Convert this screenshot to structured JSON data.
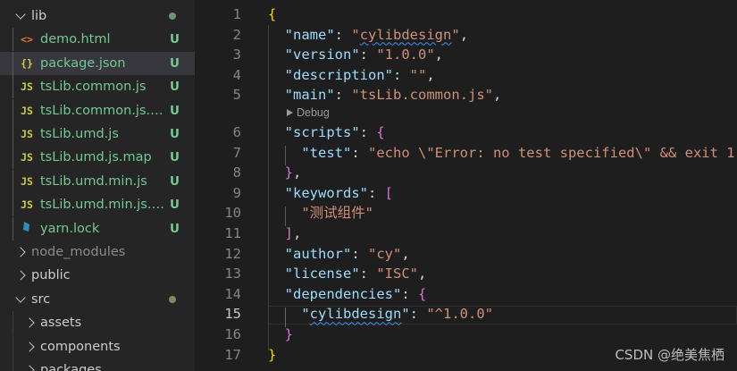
{
  "explorer": {
    "items": [
      {
        "name": "lib",
        "kind": "folder-open",
        "decoration": "dot"
      },
      {
        "name": "demo.html",
        "icon": "<>",
        "icon_color": "#e37933",
        "badge": "U"
      },
      {
        "name": "package.json",
        "icon": "{}",
        "icon_color": "#cbcb41",
        "badge": "U",
        "selected": true
      },
      {
        "name": "tsLib.common.js",
        "icon": "JS",
        "icon_color": "#cbcb41",
        "badge": "U"
      },
      {
        "name": "tsLib.common.js.m...",
        "icon": "JS",
        "icon_color": "#cbcb41",
        "badge": "U"
      },
      {
        "name": "tsLib.umd.js",
        "icon": "JS",
        "icon_color": "#cbcb41",
        "badge": "U"
      },
      {
        "name": "tsLib.umd.js.map",
        "icon": "JS",
        "icon_color": "#cbcb41",
        "badge": "U"
      },
      {
        "name": "tsLib.umd.min.js",
        "icon": "JS",
        "icon_color": "#cbcb41",
        "badge": "U"
      },
      {
        "name": "tsLib.umd.min.js.m...",
        "icon": "JS",
        "icon_color": "#cbcb41",
        "badge": "U"
      },
      {
        "name": "yarn.lock",
        "icon": "yarn",
        "icon_color": "#2c8ebb",
        "badge": "U"
      },
      {
        "name": "node_modules",
        "kind": "folder-closed",
        "dimmed": true
      },
      {
        "name": "public",
        "kind": "folder-closed"
      },
      {
        "name": "src",
        "kind": "folder-open",
        "decoration": "dot"
      },
      {
        "name": "assets",
        "kind": "folder-closed"
      },
      {
        "name": "components",
        "kind": "folder-closed"
      },
      {
        "name": "packages",
        "kind": "folder-closed"
      }
    ]
  },
  "editor": {
    "active_line": "15",
    "codelens": "Debug",
    "lines": [
      {
        "n": "1",
        "tokens": [
          [
            "{",
            "b1"
          ]
        ]
      },
      {
        "n": "2",
        "tokens": [
          [
            "  ",
            "punc"
          ],
          [
            "\"name\"",
            "key"
          ],
          [
            ": ",
            "punc"
          ],
          [
            "\"",
            "str"
          ],
          [
            "cylibdesign",
            "str squig"
          ],
          [
            "\"",
            "str"
          ],
          [
            ",",
            "punc"
          ]
        ]
      },
      {
        "n": "3",
        "tokens": [
          [
            "  ",
            "punc"
          ],
          [
            "\"version\"",
            "key"
          ],
          [
            ": ",
            "punc"
          ],
          [
            "\"1.0.0\"",
            "str"
          ],
          [
            ",",
            "punc"
          ]
        ]
      },
      {
        "n": "4",
        "tokens": [
          [
            "  ",
            "punc"
          ],
          [
            "\"description\"",
            "key"
          ],
          [
            ": ",
            "punc"
          ],
          [
            "\"\"",
            "str"
          ],
          [
            ",",
            "punc"
          ]
        ]
      },
      {
        "n": "5",
        "tokens": [
          [
            "  ",
            "punc"
          ],
          [
            "\"main\"",
            "key"
          ],
          [
            ": ",
            "punc"
          ],
          [
            "\"tsLib.common.js\"",
            "str"
          ],
          [
            ",",
            "punc"
          ]
        ]
      },
      {
        "n": "6",
        "tokens": [
          [
            "  ",
            "punc"
          ],
          [
            "\"scripts\"",
            "key"
          ],
          [
            ": ",
            "punc"
          ],
          [
            "{",
            "b2"
          ]
        ]
      },
      {
        "n": "7",
        "tokens": [
          [
            "    ",
            "punc"
          ],
          [
            "\"test\"",
            "key"
          ],
          [
            ": ",
            "punc"
          ],
          [
            "\"echo \\\"Error: no test specified\\\" && exit 1\"",
            "str"
          ]
        ]
      },
      {
        "n": "8",
        "tokens": [
          [
            "  ",
            "punc"
          ],
          [
            "}",
            "b2"
          ],
          [
            ",",
            "punc"
          ]
        ]
      },
      {
        "n": "9",
        "tokens": [
          [
            "  ",
            "punc"
          ],
          [
            "\"keywords\"",
            "key"
          ],
          [
            ": ",
            "punc"
          ],
          [
            "[",
            "b2"
          ]
        ]
      },
      {
        "n": "10",
        "tokens": [
          [
            "    ",
            "punc"
          ],
          [
            "\"测试组件\"",
            "str"
          ]
        ]
      },
      {
        "n": "11",
        "tokens": [
          [
            "  ",
            "punc"
          ],
          [
            "]",
            "b2"
          ],
          [
            ",",
            "punc"
          ]
        ]
      },
      {
        "n": "12",
        "tokens": [
          [
            "  ",
            "punc"
          ],
          [
            "\"author\"",
            "key"
          ],
          [
            ": ",
            "punc"
          ],
          [
            "\"cy\"",
            "str"
          ],
          [
            ",",
            "punc"
          ]
        ]
      },
      {
        "n": "13",
        "tokens": [
          [
            "  ",
            "punc"
          ],
          [
            "\"license\"",
            "key"
          ],
          [
            ": ",
            "punc"
          ],
          [
            "\"ISC\"",
            "str"
          ],
          [
            ",",
            "punc"
          ]
        ]
      },
      {
        "n": "14",
        "tokens": [
          [
            "  ",
            "punc"
          ],
          [
            "\"dependencies\"",
            "key"
          ],
          [
            ": ",
            "punc"
          ],
          [
            "{",
            "b2"
          ]
        ]
      },
      {
        "n": "15",
        "tokens": [
          [
            "    ",
            "punc"
          ],
          [
            "\"",
            "key"
          ],
          [
            "cylibdesign",
            "key squig"
          ],
          [
            "\"",
            "key"
          ],
          [
            ": ",
            "punc"
          ],
          [
            "\"^1.0.0\"",
            "str"
          ]
        ]
      },
      {
        "n": "16",
        "tokens": [
          [
            "  ",
            "punc"
          ],
          [
            "}",
            "b2"
          ]
        ]
      },
      {
        "n": "17",
        "tokens": [
          [
            "}",
            "b1"
          ]
        ]
      }
    ]
  },
  "watermark": "CSDN @绝美焦栖"
}
